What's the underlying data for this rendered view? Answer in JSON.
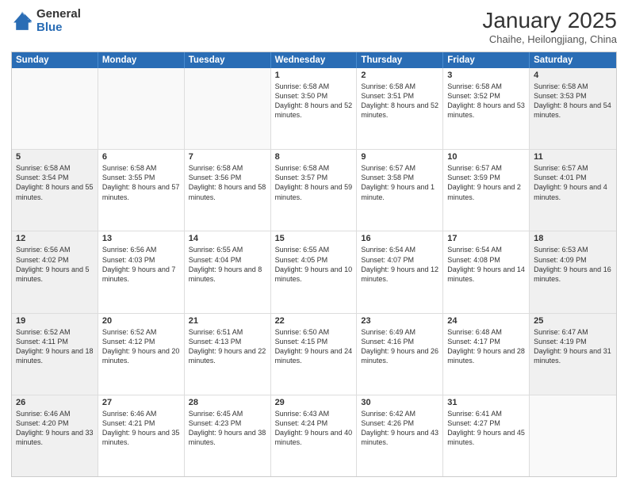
{
  "logo": {
    "general": "General",
    "blue": "Blue"
  },
  "header": {
    "month_title": "January 2025",
    "subtitle": "Chaihe, Heilongjiang, China"
  },
  "days_of_week": [
    "Sunday",
    "Monday",
    "Tuesday",
    "Wednesday",
    "Thursday",
    "Friday",
    "Saturday"
  ],
  "weeks": [
    [
      {
        "day": "",
        "info": "",
        "empty": true
      },
      {
        "day": "",
        "info": "",
        "empty": true
      },
      {
        "day": "",
        "info": "",
        "empty": true
      },
      {
        "day": "1",
        "info": "Sunrise: 6:58 AM\nSunset: 3:50 PM\nDaylight: 8 hours and 52 minutes.",
        "shaded": false
      },
      {
        "day": "2",
        "info": "Sunrise: 6:58 AM\nSunset: 3:51 PM\nDaylight: 8 hours and 52 minutes.",
        "shaded": false
      },
      {
        "day": "3",
        "info": "Sunrise: 6:58 AM\nSunset: 3:52 PM\nDaylight: 8 hours and 53 minutes.",
        "shaded": false
      },
      {
        "day": "4",
        "info": "Sunrise: 6:58 AM\nSunset: 3:53 PM\nDaylight: 8 hours and 54 minutes.",
        "shaded": true
      }
    ],
    [
      {
        "day": "5",
        "info": "Sunrise: 6:58 AM\nSunset: 3:54 PM\nDaylight: 8 hours and 55 minutes.",
        "shaded": true
      },
      {
        "day": "6",
        "info": "Sunrise: 6:58 AM\nSunset: 3:55 PM\nDaylight: 8 hours and 57 minutes.",
        "shaded": false
      },
      {
        "day": "7",
        "info": "Sunrise: 6:58 AM\nSunset: 3:56 PM\nDaylight: 8 hours and 58 minutes.",
        "shaded": false
      },
      {
        "day": "8",
        "info": "Sunrise: 6:58 AM\nSunset: 3:57 PM\nDaylight: 8 hours and 59 minutes.",
        "shaded": false
      },
      {
        "day": "9",
        "info": "Sunrise: 6:57 AM\nSunset: 3:58 PM\nDaylight: 9 hours and 1 minute.",
        "shaded": false
      },
      {
        "day": "10",
        "info": "Sunrise: 6:57 AM\nSunset: 3:59 PM\nDaylight: 9 hours and 2 minutes.",
        "shaded": false
      },
      {
        "day": "11",
        "info": "Sunrise: 6:57 AM\nSunset: 4:01 PM\nDaylight: 9 hours and 4 minutes.",
        "shaded": true
      }
    ],
    [
      {
        "day": "12",
        "info": "Sunrise: 6:56 AM\nSunset: 4:02 PM\nDaylight: 9 hours and 5 minutes.",
        "shaded": true
      },
      {
        "day": "13",
        "info": "Sunrise: 6:56 AM\nSunset: 4:03 PM\nDaylight: 9 hours and 7 minutes.",
        "shaded": false
      },
      {
        "day": "14",
        "info": "Sunrise: 6:55 AM\nSunset: 4:04 PM\nDaylight: 9 hours and 8 minutes.",
        "shaded": false
      },
      {
        "day": "15",
        "info": "Sunrise: 6:55 AM\nSunset: 4:05 PM\nDaylight: 9 hours and 10 minutes.",
        "shaded": false
      },
      {
        "day": "16",
        "info": "Sunrise: 6:54 AM\nSunset: 4:07 PM\nDaylight: 9 hours and 12 minutes.",
        "shaded": false
      },
      {
        "day": "17",
        "info": "Sunrise: 6:54 AM\nSunset: 4:08 PM\nDaylight: 9 hours and 14 minutes.",
        "shaded": false
      },
      {
        "day": "18",
        "info": "Sunrise: 6:53 AM\nSunset: 4:09 PM\nDaylight: 9 hours and 16 minutes.",
        "shaded": true
      }
    ],
    [
      {
        "day": "19",
        "info": "Sunrise: 6:52 AM\nSunset: 4:11 PM\nDaylight: 9 hours and 18 minutes.",
        "shaded": true
      },
      {
        "day": "20",
        "info": "Sunrise: 6:52 AM\nSunset: 4:12 PM\nDaylight: 9 hours and 20 minutes.",
        "shaded": false
      },
      {
        "day": "21",
        "info": "Sunrise: 6:51 AM\nSunset: 4:13 PM\nDaylight: 9 hours and 22 minutes.",
        "shaded": false
      },
      {
        "day": "22",
        "info": "Sunrise: 6:50 AM\nSunset: 4:15 PM\nDaylight: 9 hours and 24 minutes.",
        "shaded": false
      },
      {
        "day": "23",
        "info": "Sunrise: 6:49 AM\nSunset: 4:16 PM\nDaylight: 9 hours and 26 minutes.",
        "shaded": false
      },
      {
        "day": "24",
        "info": "Sunrise: 6:48 AM\nSunset: 4:17 PM\nDaylight: 9 hours and 28 minutes.",
        "shaded": false
      },
      {
        "day": "25",
        "info": "Sunrise: 6:47 AM\nSunset: 4:19 PM\nDaylight: 9 hours and 31 minutes.",
        "shaded": true
      }
    ],
    [
      {
        "day": "26",
        "info": "Sunrise: 6:46 AM\nSunset: 4:20 PM\nDaylight: 9 hours and 33 minutes.",
        "shaded": true
      },
      {
        "day": "27",
        "info": "Sunrise: 6:46 AM\nSunset: 4:21 PM\nDaylight: 9 hours and 35 minutes.",
        "shaded": false
      },
      {
        "day": "28",
        "info": "Sunrise: 6:45 AM\nSunset: 4:23 PM\nDaylight: 9 hours and 38 minutes.",
        "shaded": false
      },
      {
        "day": "29",
        "info": "Sunrise: 6:43 AM\nSunset: 4:24 PM\nDaylight: 9 hours and 40 minutes.",
        "shaded": false
      },
      {
        "day": "30",
        "info": "Sunrise: 6:42 AM\nSunset: 4:26 PM\nDaylight: 9 hours and 43 minutes.",
        "shaded": false
      },
      {
        "day": "31",
        "info": "Sunrise: 6:41 AM\nSunset: 4:27 PM\nDaylight: 9 hours and 45 minutes.",
        "shaded": false
      },
      {
        "day": "",
        "info": "",
        "empty": true
      }
    ]
  ]
}
